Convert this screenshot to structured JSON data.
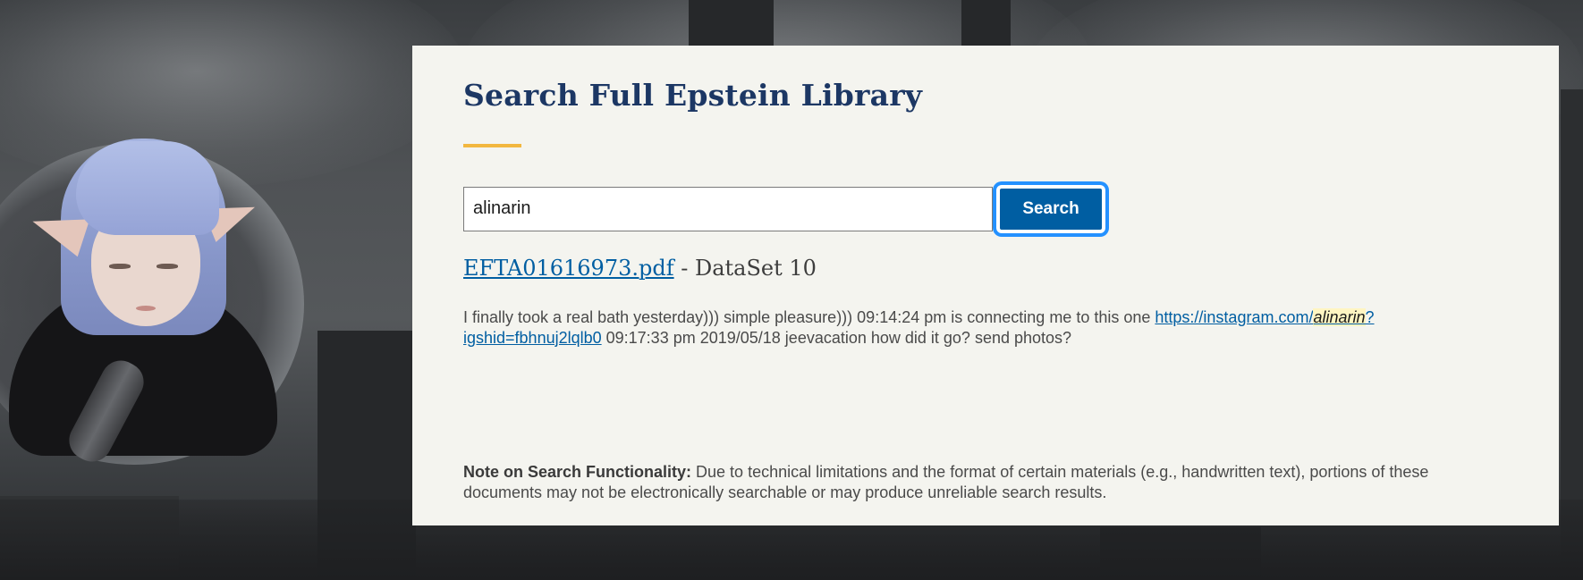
{
  "page": {
    "title": "Search Full Epstein Library"
  },
  "search": {
    "query": "alinarin",
    "button_label": "Search"
  },
  "result": {
    "file_name": "EFTA01616973.pdf",
    "dataset": "- DataSet 10",
    "snippet_before": "I finally took a real bath yesterday))) simple pleasure))) 09:14:24 pm is connecting me to this one ",
    "link_prefix": "https://instagram.com/",
    "link_highlight": "alinarin",
    "link_suffix": "?igshid=fbhnuj2lqlb0",
    "snippet_after": " 09:17:33 pm 2019/05/18 jeevacation how did it go? send photos?"
  },
  "note": {
    "label": "Note on Search Functionality:",
    "text": " Due to technical limitations and the format of certain materials (e.g., handwritten text), portions of these documents may not be electronically searchable or may produce unreliable search results."
  },
  "colors": {
    "panel_background": "#f4f4ef",
    "title": "#1c3764",
    "accent_rule": "#f2b73f",
    "button": "#005ea2",
    "focus_ring": "#2491ff",
    "link": "#005ea2",
    "highlight": "#fff5c2"
  }
}
